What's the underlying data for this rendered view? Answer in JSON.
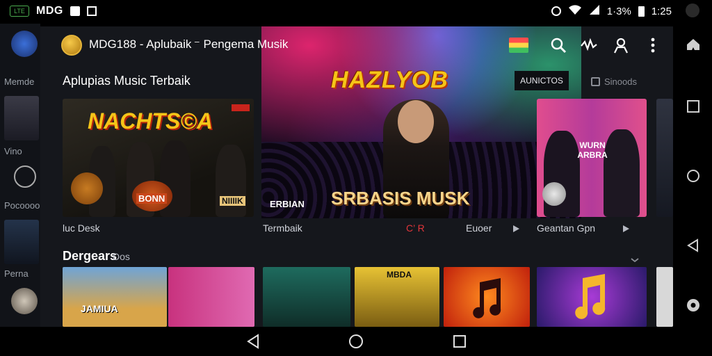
{
  "status_bar": {
    "badge": "LTE",
    "app_name": "MDG",
    "battery_text": "1·3%",
    "time": "1:25"
  },
  "peek_app": {
    "labels": [
      "Memde",
      "Vino",
      "Pocoooo",
      "Perna"
    ]
  },
  "app": {
    "title": "MDG188 - Aplubaik ⁻ Pengema Musik",
    "accent_color": "#f5c518"
  },
  "section1": {
    "title": "Aplupias Music Terbaik",
    "right_label": "Sinoods",
    "cards": [
      {
        "headline": "NACHTS©A",
        "overlay_bottom": "BONN",
        "overlay_right": "NIIIIK",
        "caption": "luc Desk"
      },
      {
        "caption": "Termbaik",
        "badge": "AUNICTOS",
        "logo": "HAZLYOB",
        "overlay_text": "SRBASIS MUSK",
        "overlay_small": "ERBIAN",
        "extra1": "C’ R",
        "extra2": "Euoer"
      },
      {
        "headline": "WURN ARBRA",
        "caption": "Geantan Gpn"
      }
    ]
  },
  "section2": {
    "title": "Dergears",
    "subtitle": "Dos",
    "thumb_labels": [
      "JAMIUA",
      "MBDA"
    ]
  },
  "icons": {
    "topbar": [
      "flag-icon",
      "search-icon",
      "waveform-icon",
      "person-icon",
      "more-vert-icon"
    ],
    "sidenav": [
      "home-shape-icon",
      "square-icon",
      "circle-icon",
      "back-triangle-icon",
      "settings-icon"
    ],
    "bottomnav": [
      "back-icon",
      "home-icon",
      "recents-icon"
    ]
  }
}
